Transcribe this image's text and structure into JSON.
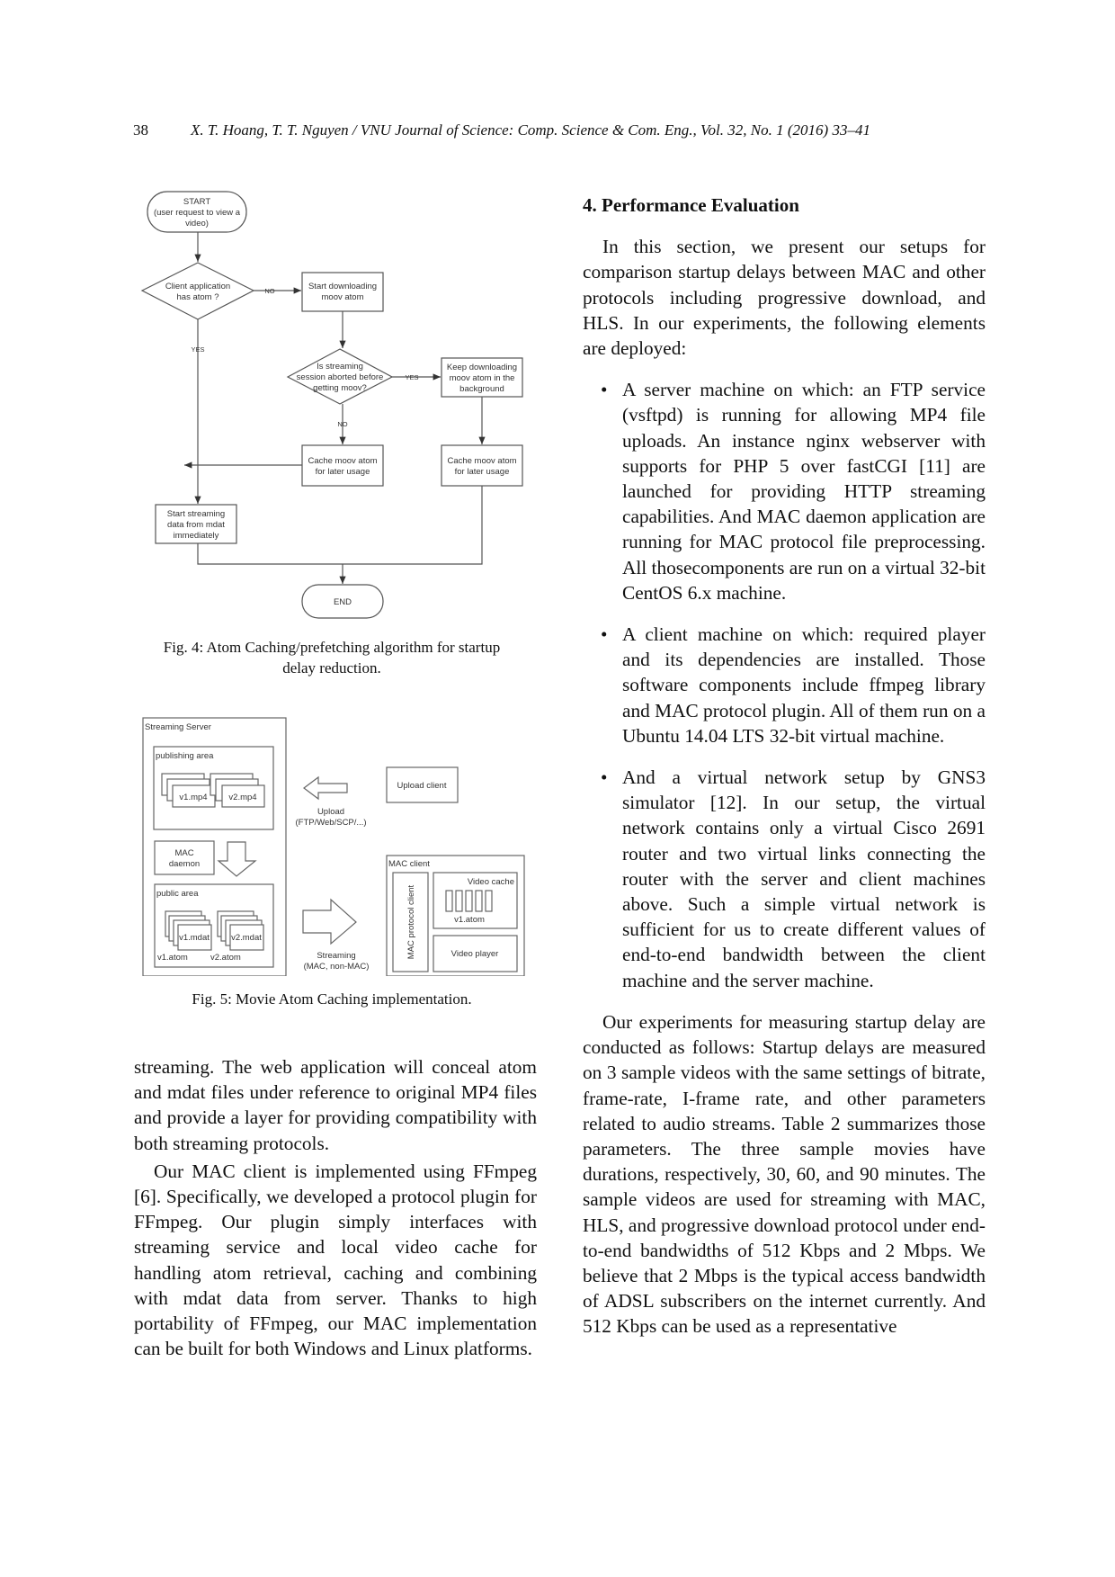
{
  "header": {
    "page_number": "38",
    "running_head": "X. T. Hoang, T. T. Nguyen / VNU Journal of Science: Comp. Science & Com. Eng., Vol. 32, No. 1 (2016) 33–41"
  },
  "figure4": {
    "caption_line1": "Fig. 4: Atom Caching/prefetching algorithm for startup",
    "caption_line2": "delay reduction.",
    "nodes": {
      "start_l1": "START",
      "start_l2": "(user request to view a",
      "start_l3": "video)",
      "decision1_l1": "Client application",
      "decision1_l2": "has atom ?",
      "start_download_l1": "Start downloading",
      "start_download_l2": "moov atom",
      "decision2_l1": "Is streaming",
      "decision2_l2": "session aborted before",
      "decision2_l3": "getting moov?",
      "keep_download_l1": "Keep downloading",
      "keep_download_l2": "moov atom in the",
      "keep_download_l3": "background",
      "cache1_l1": "Cache moov atom",
      "cache1_l2": "for later usage",
      "cache2_l1": "Cache moov atom",
      "cache2_l2": "for later usage",
      "stream_l1": "Start streaming",
      "stream_l2": "data from mdat",
      "stream_l3": "immediately",
      "end": "END"
    },
    "edge_labels": {
      "no1": "NO",
      "yes1": "YES",
      "yes2": "YES",
      "no2": "NO"
    }
  },
  "figure5": {
    "caption": "Fig. 5: Movie Atom Caching implementation.",
    "streaming_server": "Streaming Server",
    "publishing_area": "publishing area",
    "v1_mp4": "v1.mp4",
    "v2_mp4": "v2.mp4",
    "mac_daemon_l1": "MAC",
    "mac_daemon_l2": "daemon",
    "public_area": "public area",
    "v1_mdat": "v1.mdat",
    "v2_mdat": "v2.mdat",
    "v1_atom": "v1.atom",
    "v2_atom": "v2.atom",
    "upload_client": "Upload client",
    "upload_l1": "Upload",
    "upload_l2": "(FTP/Web/SCP/...)",
    "streaming_l1": "Streaming",
    "streaming_l2": "(MAC, non-MAC)",
    "mac_client": "MAC client",
    "mac_protocol_client": "MAC protocol client",
    "video_cache": "Video cache",
    "cache_v1_atom": "v1.atom",
    "video_player": "Video player"
  },
  "left_column": {
    "paragraph1": "streaming. The web application will conceal atom and mdat files under reference to original MP4 files and provide a layer for providing compatibility with both streaming protocols.",
    "paragraph2": "Our MAC client is implemented using FFmpeg [6]. Specifically, we developed a protocol plugin for FFmpeg. Our plugin simply interfaces with streaming service and local video cache for handling atom retrieval, caching and combining with mdat data from server. Thanks to high portability of FFmpeg, our MAC implementation can be built for both Windows and Linux platforms."
  },
  "right_column": {
    "section_title": "4. Performance Evaluation",
    "intro": "In this section, we present our setups for comparison startup delays between MAC and other protocols including progressive download, and HLS. In our experiments, the following elements are deployed:",
    "bullets": [
      "A server machine on which: an FTP service (vsftpd) is running for allowing MP4 file uploads. An instance nginx webserver with supports for PHP 5 over fastCGI [11] are launched for providing HTTP streaming capabilities. And MAC daemon application are running for MAC protocol file preprocessing. All thosecomponents are run on a virtual 32-bit CentOS 6.x machine.",
      "A client machine on which: required player and its dependencies are installed. Those software components include ffmpeg library and MAC protocol plugin. All of them run on a Ubuntu 14.04 LTS 32-bit virtual machine.",
      "And a virtual network setup by GNS3 simulator [12]. In our setup, the virtual network contains only a virtual Cisco 2691 router and two virtual links connecting the router with the server and client machines above. Such a simple virtual network is sufficient for us to create different values of end-to-end bandwidth between the client machine and the server machine."
    ],
    "bullet_symbol": "•",
    "paragraph_experiments": "Our experiments for measuring startup delay are conducted as follows: Startup delays are measured on 3 sample videos with the same settings of bitrate, frame-rate, I-frame rate, and other parameters related to audio streams. Table 2 summarizes those parameters. The three sample movies have durations, respectively, 30, 60, and 90 minutes. The sample videos are used for streaming with MAC, HLS, and progressive download protocol under end-to-end bandwidths of 512 Kbps and 2 Mbps. We believe that 2 Mbps is the typical access bandwidth of ADSL subscribers on the internet currently. And 512 Kbps can be used as a representative"
  }
}
